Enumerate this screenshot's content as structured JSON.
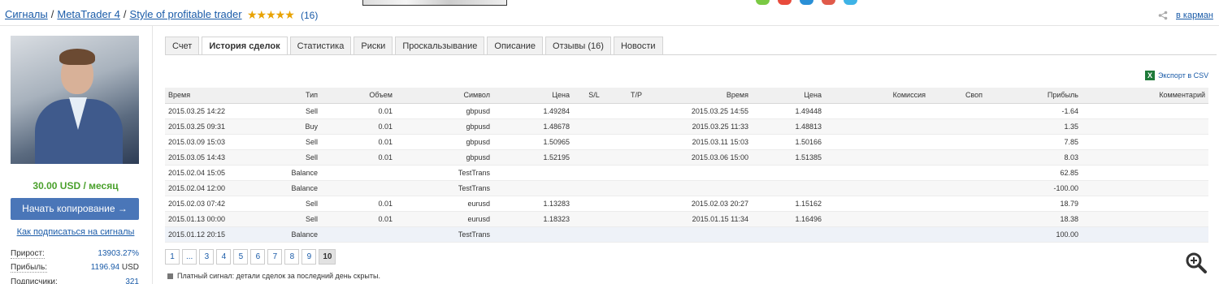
{
  "breadcrumb": {
    "item1": "Сигналы",
    "item2": "MetaTrader 4",
    "item3": "Style of profitable trader",
    "sep": "/"
  },
  "rating": {
    "stars": "★★★★★",
    "value": 4.5,
    "count": "(16)"
  },
  "wallet": {
    "label": "в карман"
  },
  "sidebar": {
    "price": "30.00 USD / месяц",
    "copy_button": "Начать копирование →",
    "howto_link": "Как подписаться на сигналы",
    "stats": [
      {
        "label": "Прирост:",
        "value": "13903.27%",
        "unit": ""
      },
      {
        "label": "Прибыль:",
        "value": "1196.94",
        "unit": " USD"
      },
      {
        "label": "Подписчики:",
        "value": "321",
        "unit": ""
      }
    ]
  },
  "tabs": [
    "Счет",
    "История сделок",
    "Статистика",
    "Риски",
    "Проскальзывание",
    "Описание",
    "Отзывы (16)",
    "Новости"
  ],
  "export": {
    "icon_text": "X",
    "label": "Экспорт в CSV"
  },
  "table": {
    "headers": [
      "Время",
      "Тип",
      "Объем",
      "Символ",
      "Цена",
      "S/L",
      "T/P",
      "Время",
      "Цена",
      "Комиссия",
      "Своп",
      "Прибыль",
      "Комментарий"
    ],
    "rows": [
      [
        "2015.03.25 14:22",
        "Sell",
        "0.01",
        "gbpusd",
        "1.49284",
        "",
        "",
        "2015.03.25 14:55",
        "1.49448",
        "",
        "",
        "-1.64",
        ""
      ],
      [
        "2015.03.25 09:31",
        "Buy",
        "0.01",
        "gbpusd",
        "1.48678",
        "",
        "",
        "2015.03.25 11:33",
        "1.48813",
        "",
        "",
        "1.35",
        ""
      ],
      [
        "2015.03.09 15:03",
        "Sell",
        "0.01",
        "gbpusd",
        "1.50965",
        "",
        "",
        "2015.03.11 15:03",
        "1.50166",
        "",
        "",
        "7.85",
        ""
      ],
      [
        "2015.03.05 14:43",
        "Sell",
        "0.01",
        "gbpusd",
        "1.52195",
        "",
        "",
        "2015.03.06 15:00",
        "1.51385",
        "",
        "",
        "8.03",
        ""
      ],
      [
        "2015.02.04 15:05",
        "Balance",
        "",
        "TestTrans",
        "",
        "",
        "",
        "",
        "",
        "",
        "",
        "62.85",
        ""
      ],
      [
        "2015.02.04 12:00",
        "Balance",
        "",
        "TestTrans",
        "",
        "",
        "",
        "",
        "",
        "",
        "",
        "-100.00",
        ""
      ],
      [
        "2015.02.03 07:42",
        "Sell",
        "0.01",
        "eurusd",
        "1.13283",
        "",
        "",
        "2015.02.03 20:27",
        "1.15162",
        "",
        "",
        "18.79",
        ""
      ],
      [
        "2015.01.13 00:00",
        "Sell",
        "0.01",
        "eurusd",
        "1.18323",
        "",
        "",
        "2015.01.15 11:34",
        "1.16496",
        "",
        "",
        "18.38",
        ""
      ],
      [
        "2015.01.12 20:15",
        "Balance",
        "",
        "TestTrans",
        "",
        "",
        "",
        "",
        "",
        "",
        "",
        "100.00",
        ""
      ]
    ]
  },
  "pagination": [
    "1",
    "...",
    "3",
    "4",
    "5",
    "6",
    "7",
    "8",
    "9",
    "10"
  ],
  "pagination_current": "10",
  "note": "Платный сигнал: детали сделок за последний день скрыты.",
  "colors": {
    "link": "#1a5ba8",
    "profit_positive": "#1a5ba8",
    "profit_negative": "#cc0000",
    "price": "#4aa02c",
    "button": "#4a76b8"
  },
  "icons": {
    "zoom": "zoom-in-icon",
    "share": "share-icon",
    "excel": "excel-icon"
  }
}
